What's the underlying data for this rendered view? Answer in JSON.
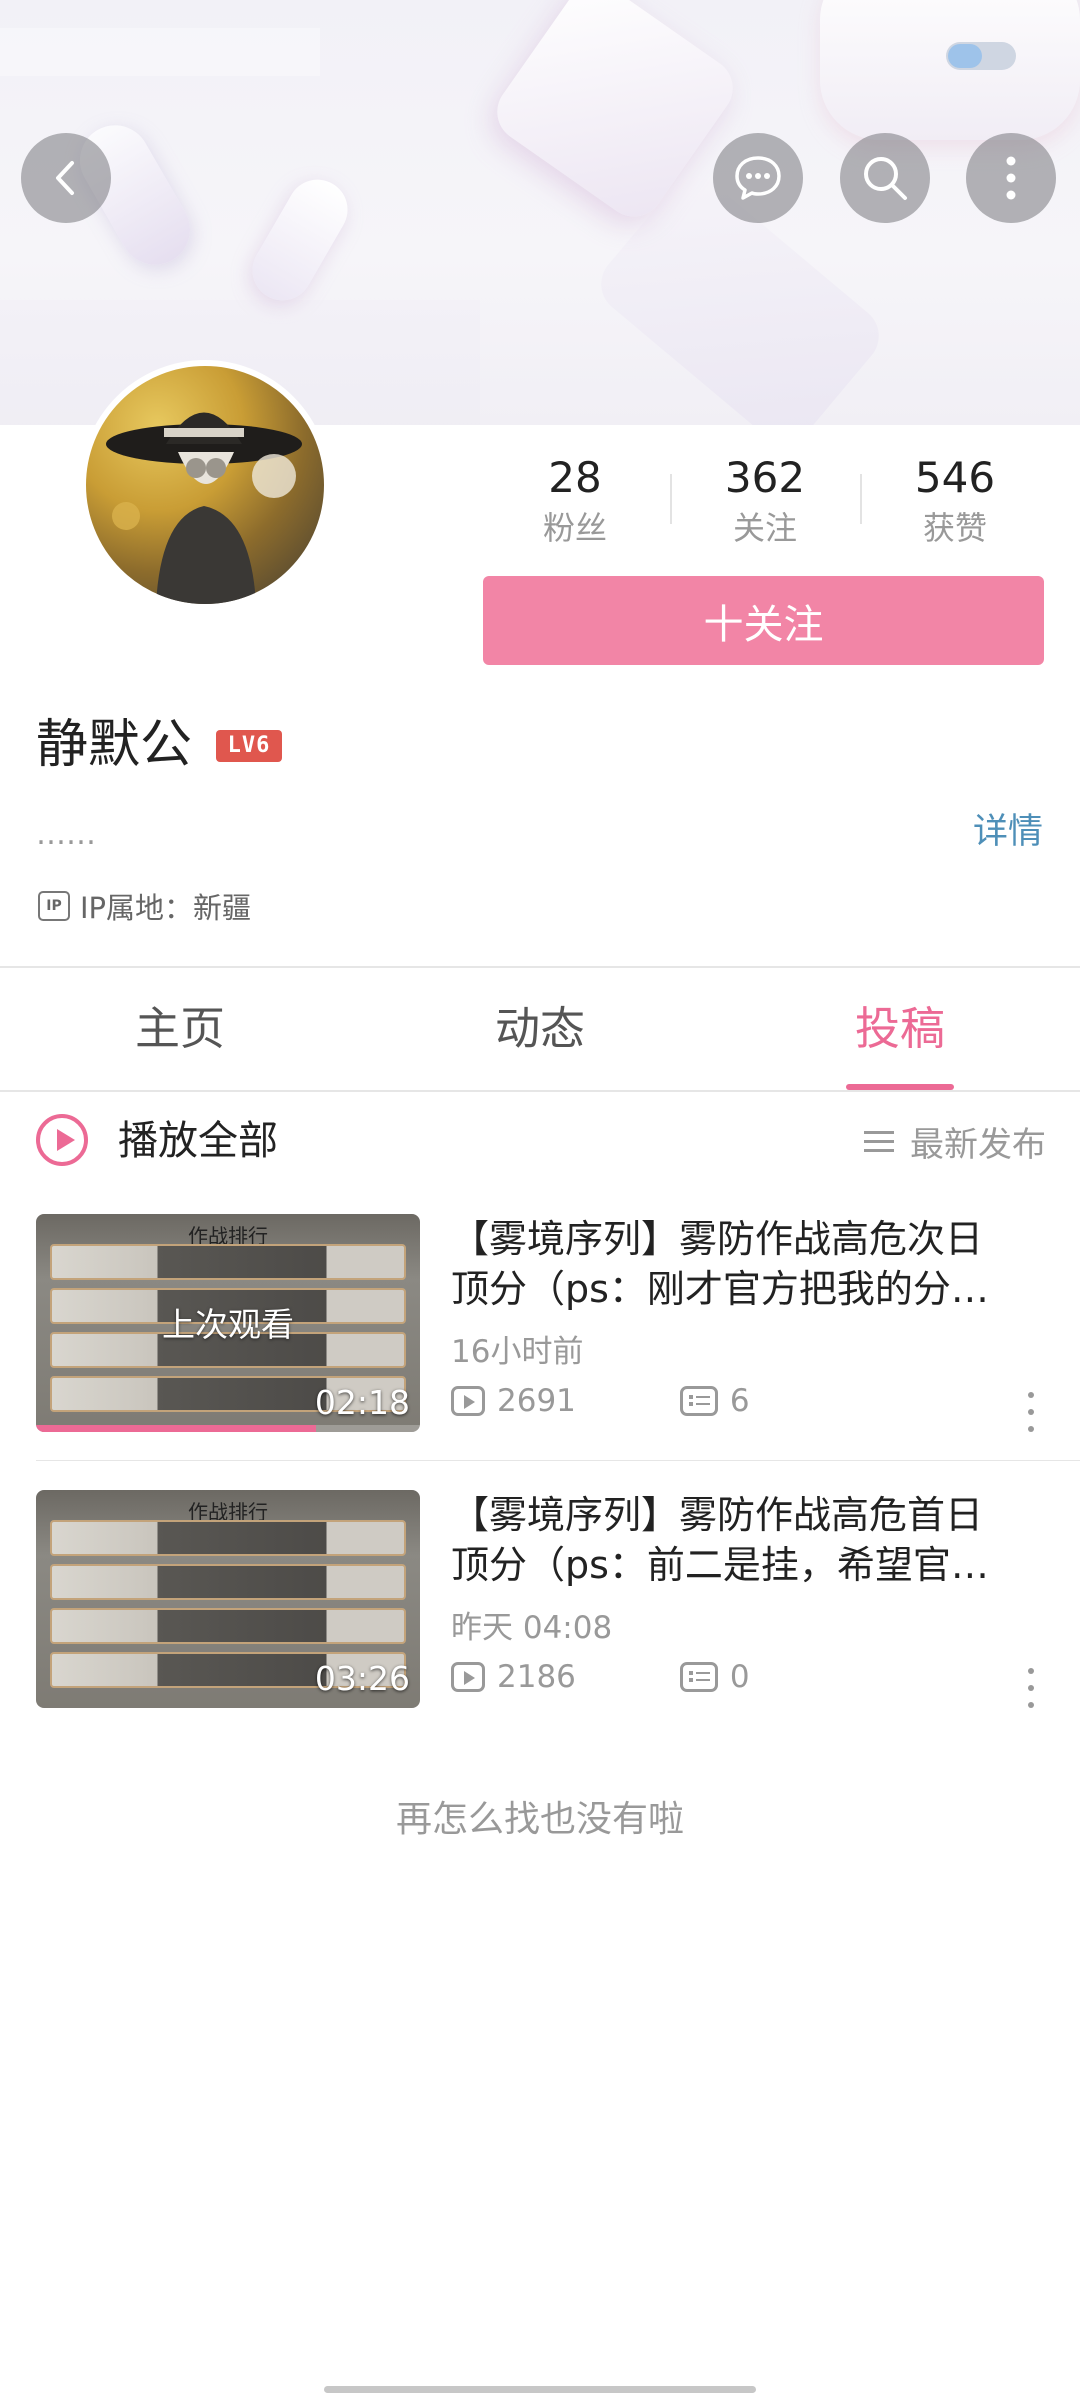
{
  "profile": {
    "username": "静默公",
    "level_badge": "LV6",
    "signature": "……",
    "detail_link": "详情",
    "ip_icon_text": "IP",
    "ip_location": "IP属地：新疆",
    "follow_button": "十关注",
    "stats": [
      {
        "value": "28",
        "label": "粉丝"
      },
      {
        "value": "362",
        "label": "关注"
      },
      {
        "value": "546",
        "label": "获赞"
      }
    ]
  },
  "tabs": [
    {
      "label": "主页",
      "active": false
    },
    {
      "label": "动态",
      "active": false
    },
    {
      "label": "投稿",
      "active": true
    }
  ],
  "list_header": {
    "play_all": "播放全部",
    "sort": "最新发布"
  },
  "videos": [
    {
      "title_line1": "【雾境序列】雾防作战高危次日",
      "title_line2": "顶分（ps：刚才官方把我的分…",
      "time": "16小时前",
      "views": "2691",
      "comments": "6",
      "duration": "02:18",
      "overlay": "上次观看",
      "thumb_title": "作战排行",
      "watch_progress": 0.73
    },
    {
      "title_line1": "【雾境序列】雾防作战高危首日",
      "title_line2": "顶分（ps：前二是挂，希望官…",
      "time": "昨天 04:08",
      "views": "2186",
      "comments": "0",
      "duration": "03:26",
      "thumb_title": "作战排行"
    }
  ],
  "footer": {
    "end_text": "再怎么找也没有啦"
  },
  "colors": {
    "accent": "#ec6a95",
    "follow_button": "#f285a6",
    "level_badge": "#e0574e",
    "link": "#4e8fb8"
  },
  "icons": [
    "back-icon",
    "message-icon",
    "search-icon",
    "more-icon",
    "play-circle-icon",
    "sort-list-icon",
    "view-count-icon",
    "comment-icon",
    "ip-icon"
  ]
}
